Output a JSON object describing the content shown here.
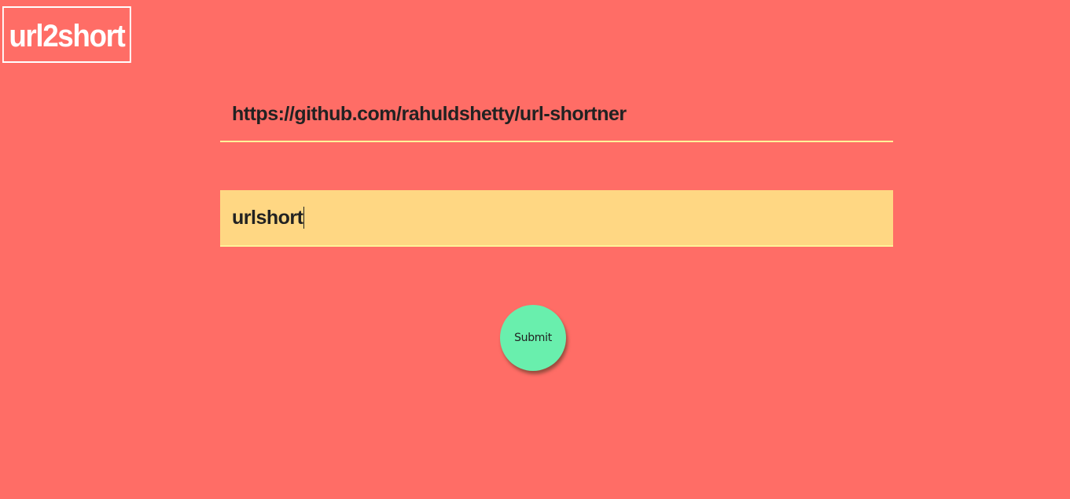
{
  "app": {
    "logo_text": "url2short"
  },
  "form": {
    "url_value": "https://github.com/rahuldshetty/url-shortner",
    "alias_value": "urlshort",
    "submit_label": "Submit"
  },
  "colors": {
    "background": "#ff6d66",
    "alias_field_background": "#ffd783",
    "field_underline": "#fff29a",
    "submit_button": "#69efad",
    "logo_text": "#ffffff"
  }
}
